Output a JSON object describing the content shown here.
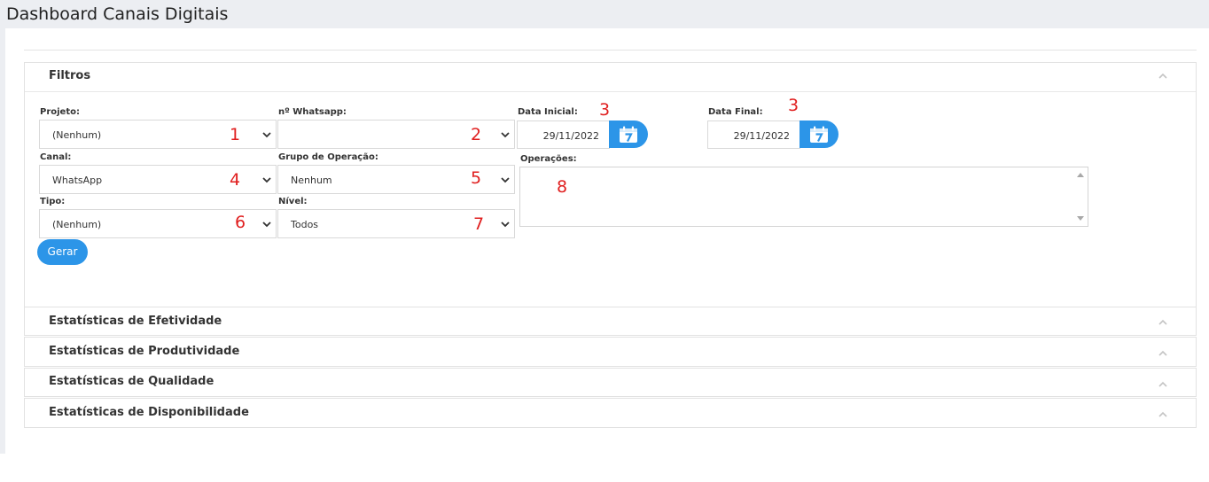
{
  "page": {
    "title": "Dashboard Canais Digitais"
  },
  "filtros": {
    "title": "Filtros",
    "projeto": {
      "label": "Projeto:",
      "value": "(Nenhum)",
      "marker": "1"
    },
    "whatsapp": {
      "label": "nº Whatsapp:",
      "value": "",
      "marker": "2"
    },
    "data_inicial": {
      "label": "Data Inicial:",
      "value": "29/11/2022",
      "marker": "3"
    },
    "data_final": {
      "label": "Data Final:",
      "value": "29/11/2022",
      "marker": "3"
    },
    "canal": {
      "label": "Canal:",
      "value": "WhatsApp",
      "marker": "4"
    },
    "grupo": {
      "label": "Grupo de Operação:",
      "value": "Nenhum",
      "marker": "5"
    },
    "operacoes": {
      "label": "Operações:",
      "marker": "8"
    },
    "tipo": {
      "label": "Tipo:",
      "value": "(Nenhum)",
      "marker": "6"
    },
    "nivel": {
      "label": "Nível:",
      "value": "Todos",
      "marker": "7"
    },
    "gerar_label": "Gerar"
  },
  "sections": {
    "efetividade": "Estatísticas de Efetividade",
    "produtividade": "Estatísticas de Produtividade",
    "qualidade": "Estatísticas de Qualidade",
    "disponibilidade": "Estatísticas de Disponibilidade"
  },
  "icons": {
    "calendar": "calendar-icon",
    "collapse": "chevron-up-icon",
    "dropdown": "chevron-down-icon"
  },
  "colors": {
    "accent": "#2c95e8",
    "marker": "#e01f1f"
  }
}
